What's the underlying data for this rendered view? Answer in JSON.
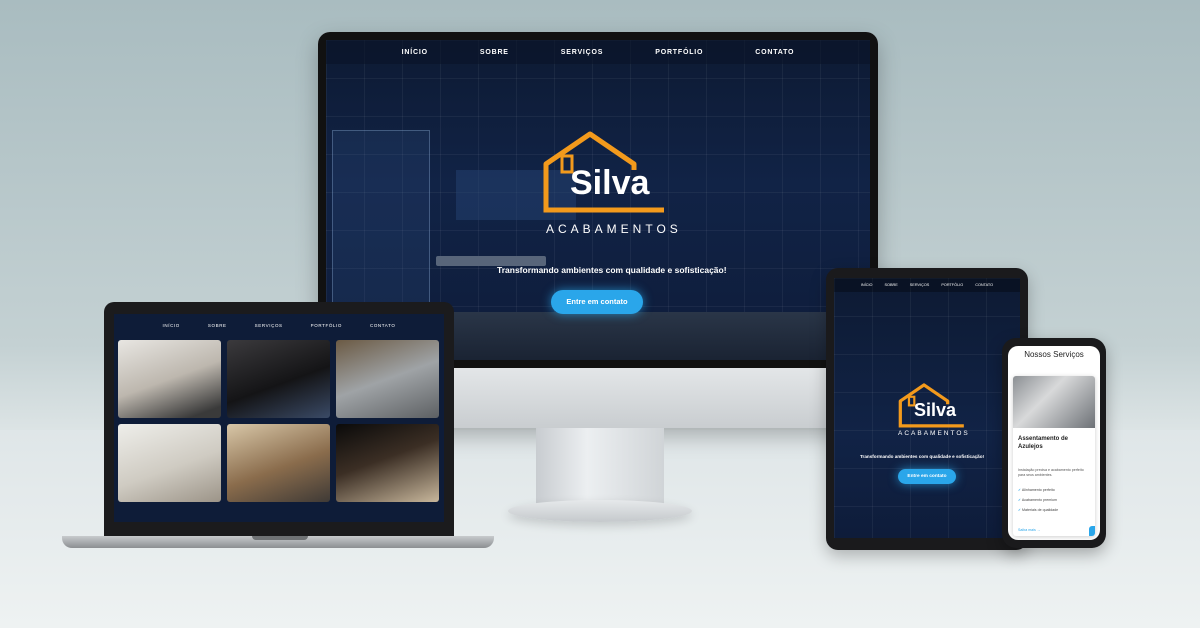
{
  "colors": {
    "brand_orange": "#f39a1c",
    "accent_blue": "#2aa6ea",
    "screen_navy": "#0e1c38"
  },
  "desktop": {
    "nav": [
      "INÍCIO",
      "SOBRE",
      "SERVIÇOS",
      "PORTFÓLIO",
      "CONTATO"
    ],
    "logo_name": "Silva",
    "logo_sub": "ACABAMENTOS",
    "tagline": "Transformando ambientes com qualidade e sofisticação!",
    "cta": "Entre em contato"
  },
  "laptop": {
    "nav": [
      "INÍCIO",
      "SOBRE",
      "SERVIÇOS",
      "PORTFÓLIO",
      "CONTATO"
    ],
    "photos": [
      "bathroom-photo",
      "kitchen-dark-photo",
      "kitchen-steel-photo",
      "empty-room-photo",
      "rustic-kitchen-photo",
      "flooring-install-photo"
    ]
  },
  "tablet": {
    "nav": [
      "INÍCIO",
      "SOBRE",
      "SERVIÇOS",
      "PORTFÓLIO",
      "CONTATO"
    ],
    "logo_name": "Silva",
    "logo_sub": "ACABAMENTOS",
    "tagline": "Transformando ambientes com qualidade e sofisticação!",
    "cta": "Entre em contato"
  },
  "phone": {
    "section_title": "Nossos Serviços",
    "card_title": "Assentamento de Azulejos",
    "card_desc": "Instalação precisa e acabamento perfeito para seus ambientes.",
    "features": [
      "Alinhamento perfeito",
      "Acabamento premium",
      "Materiais de qualidade"
    ],
    "link": "Saiba mais →"
  }
}
